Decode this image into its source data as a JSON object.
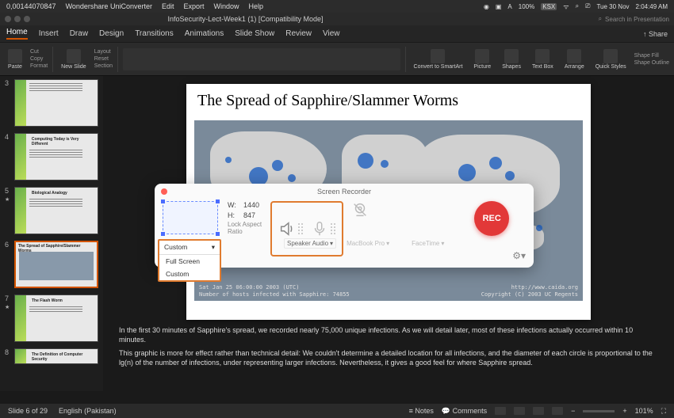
{
  "macMenubar": {
    "overlayText": "0,00144070847",
    "appName": "Wondershare UniConverter",
    "items": [
      "Edit",
      "Export",
      "Window",
      "Help"
    ],
    "right": {
      "battery": "100%",
      "batteryBadge": "KSX",
      "date": "Tue 30 Nov",
      "time": "2:04:49 AM"
    }
  },
  "titlebar": {
    "doc": "InfoSecurity-Lect-Week1 (1) [Compatibility Mode]",
    "searchPlaceholder": "Search in Presentation"
  },
  "ribbonTabs": [
    "Home",
    "Insert",
    "Draw",
    "Design",
    "Transitions",
    "Animations",
    "Slide Show",
    "Review",
    "View"
  ],
  "share": "Share",
  "ribbon": {
    "paste": "Paste",
    "cut": "Cut",
    "copy": "Copy",
    "format": "Format",
    "newSlide": "New Slide",
    "layout": "Layout",
    "reset": "Reset",
    "section": "Section",
    "convert": "Convert to SmartArt",
    "picture": "Picture",
    "shapes": "Shapes",
    "textbox": "Text Box",
    "arrange": "Arrange",
    "quick": "Quick Styles",
    "shapeFill": "Shape Fill",
    "shapeOutline": "Shape Outline"
  },
  "thumbs": {
    "n3": "3",
    "n4": "4",
    "n5": "5",
    "n6": "6",
    "n7": "7",
    "n8": "8",
    "t4": "Computing Today is Very Different",
    "t5": "Biological Analogy",
    "t6": "The Spread of Sapphire/Slammer Worms",
    "t7": "The Flash Worm",
    "t8": "The Definition of Computer Security"
  },
  "slide": {
    "title": "The Spread of Sapphire/Slammer Worms",
    "caption_time": "Sat Jan 25 06:00:00 2003 (UTC)",
    "caption_url": "http://www.caida.org",
    "caption_hosts": "Number of hosts infected with Sapphire: 74855",
    "caption_copy": "Copyright (C) 2003 UC Regents"
  },
  "notes": {
    "p1": "In the first 30 minutes of Sapphire's spread, we recorded nearly 75,000 unique infections.  As we will detail later, most of these infections actually occurred within 10 minutes.",
    "p2": "This graphic is more for effect rather than technical detail: We couldn't determine a detailed location for all infections, and the diameter of each circle is proportional to the lg(n) of the number of infections, under representing larger infections.  Nevertheless, it gives a good feel for where Sapphire spread."
  },
  "statusbar": {
    "slide": "Slide 6 of 29",
    "lang": "English (Pakistan)",
    "notes": "Notes",
    "comments": "Comments",
    "zoom": "101%"
  },
  "recorder": {
    "title": "Screen Recorder",
    "wLabel": "W:",
    "wVal": "1440",
    "hLabel": "H:",
    "hVal": "847",
    "lockAspect": "Lock Aspect Ratio",
    "speaker": "Speaker Audio",
    "mic": "MacBook Pro",
    "cam": "FaceTime",
    "rec": "REC",
    "dropdown": {
      "selected": "Custom",
      "opt1": "Full Screen",
      "opt2": "Custom"
    }
  }
}
